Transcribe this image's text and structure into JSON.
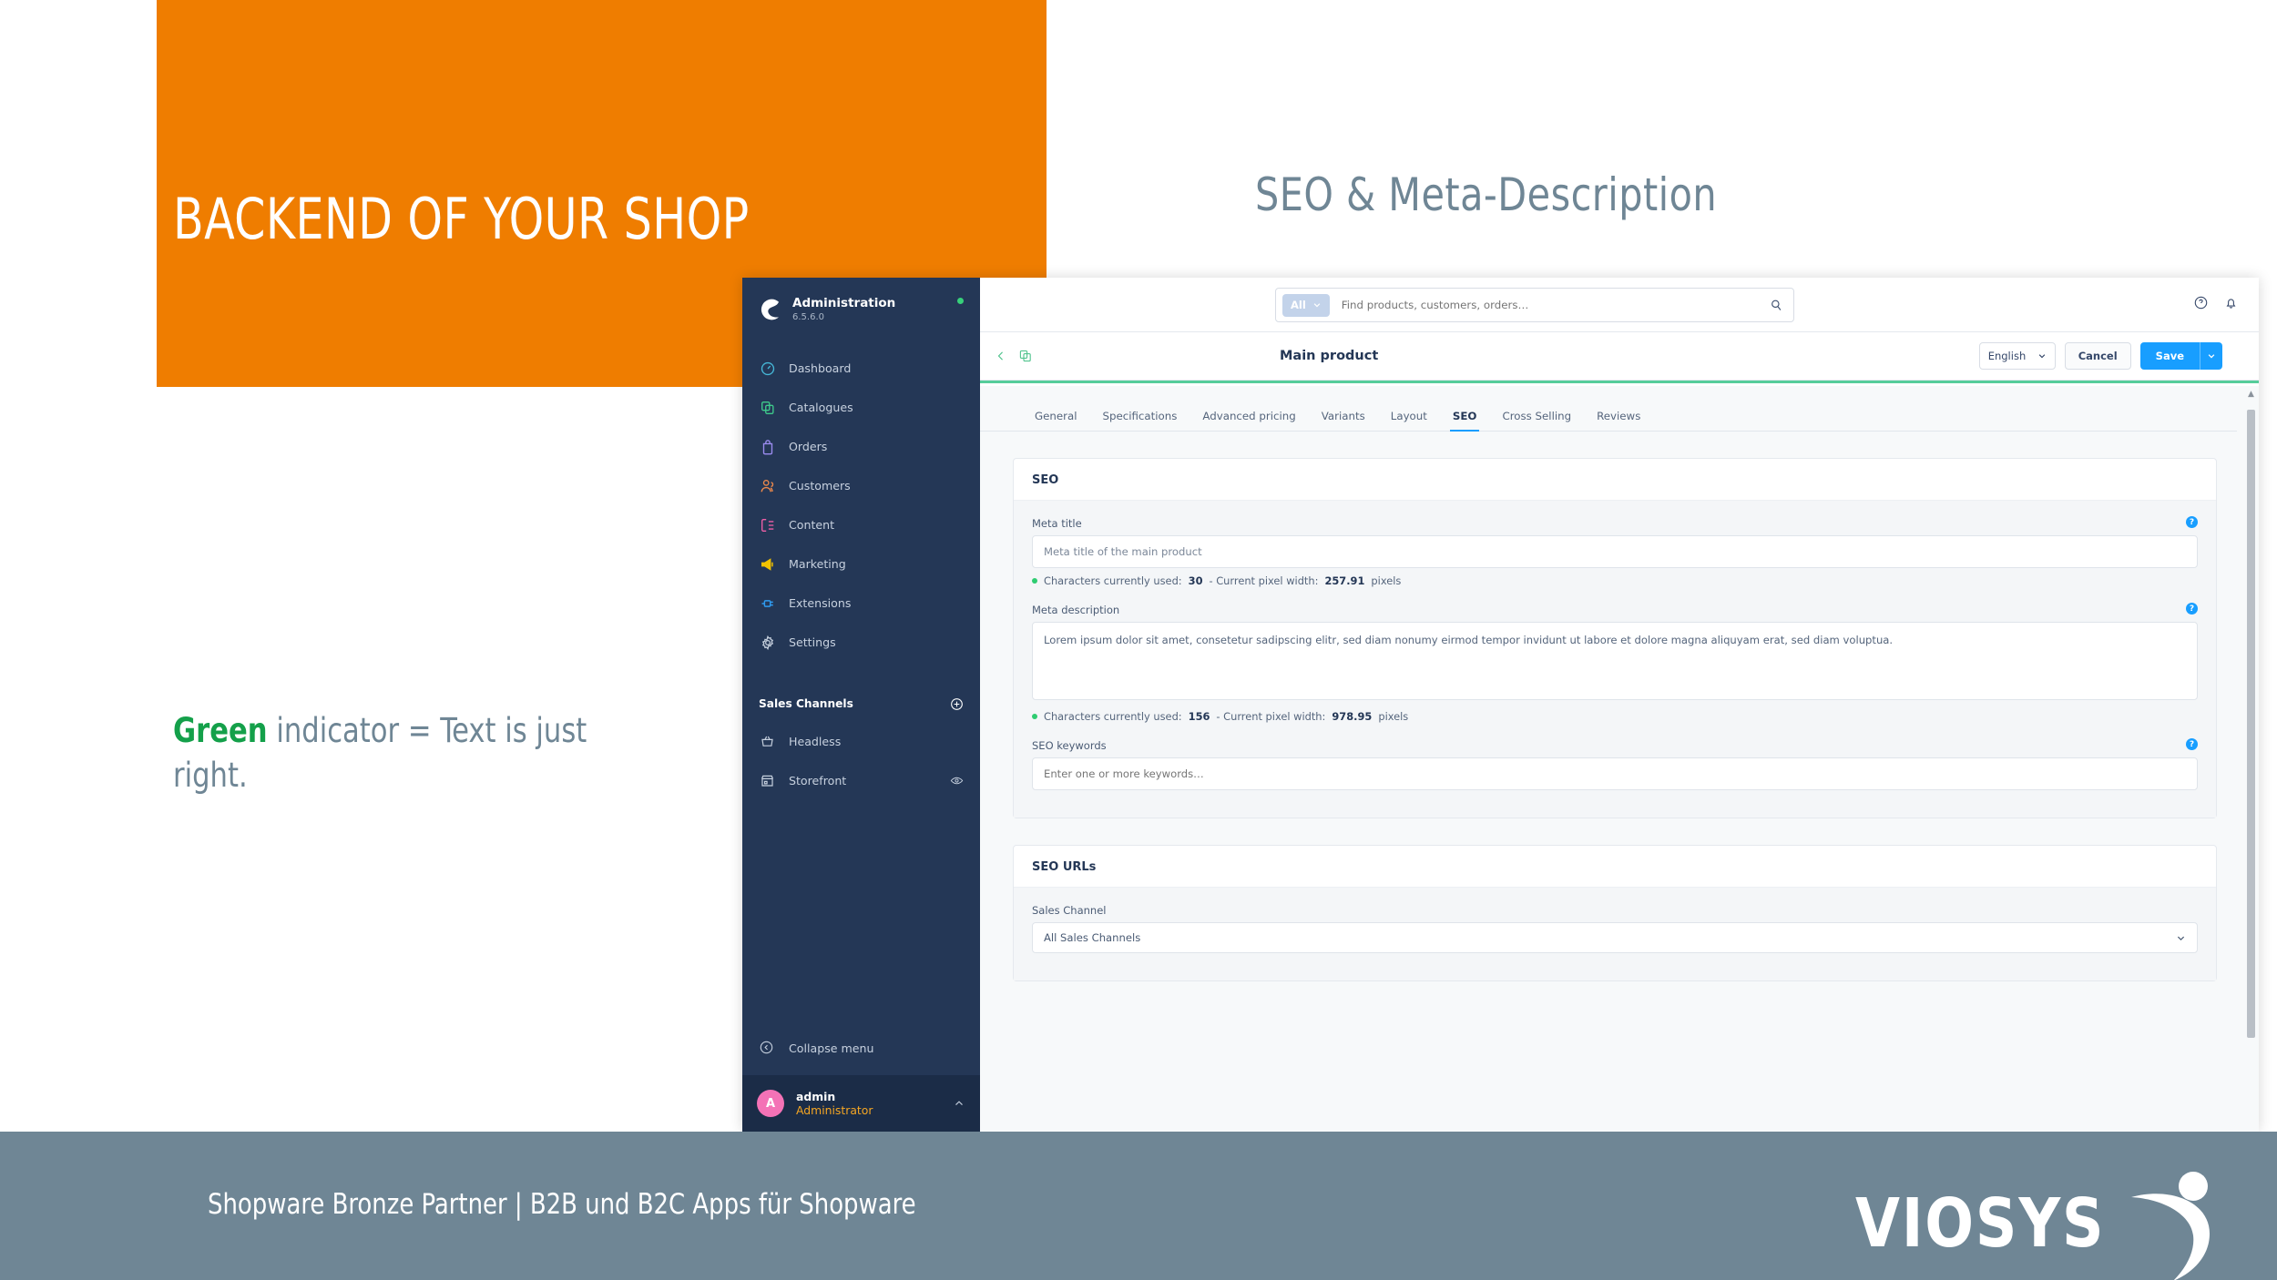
{
  "theme": {
    "orange": "#EF7D00",
    "slate": "#6F8695",
    "green": "#14A04A",
    "sidebar_navy": "#243756",
    "primary_blue": "#189EFF",
    "accent_green": "#56CD9A"
  },
  "slide": {
    "title": "BACKEND OF YOUR SHOP",
    "headline": "SEO & Meta-Description",
    "caption_highlight": "Green",
    "caption_rest": " indicator = Text is just right."
  },
  "footer": {
    "text": "Shopware Bronze Partner  |  B2B und B2C Apps für Shopware",
    "logo_text": "VIOSYS"
  },
  "app": {
    "sidebar": {
      "brand_name": "Administration",
      "brand_version": "6.5.6.0",
      "status_indicator": "online-dot",
      "nav": [
        {
          "label": "Dashboard",
          "icon": "gauge-icon"
        },
        {
          "label": "Catalogues",
          "icon": "copy-icon"
        },
        {
          "label": "Orders",
          "icon": "bag-icon"
        },
        {
          "label": "Customers",
          "icon": "users-icon"
        },
        {
          "label": "Content",
          "icon": "content-icon"
        },
        {
          "label": "Marketing",
          "icon": "megaphone-icon"
        },
        {
          "label": "Extensions",
          "icon": "plug-icon"
        },
        {
          "label": "Settings",
          "icon": "gear-icon"
        }
      ],
      "group_label": "Sales Channels",
      "channels": [
        {
          "label": "Headless",
          "icon": "basket-icon"
        },
        {
          "label": "Storefront",
          "icon": "store-icon"
        }
      ],
      "collapse_label": "Collapse menu",
      "user_initial": "A",
      "user_name": "admin",
      "user_role": "Administrator"
    },
    "topbar": {
      "scope_label": "All",
      "search_placeholder": "Find products, customers, orders…",
      "search_value": ""
    },
    "subbar": {
      "title": "Main product",
      "language": "English",
      "cancel_label": "Cancel",
      "save_label": "Save"
    },
    "tabs": [
      {
        "label": "General",
        "active": false
      },
      {
        "label": "Specifications",
        "active": false
      },
      {
        "label": "Advanced pricing",
        "active": false
      },
      {
        "label": "Variants",
        "active": false
      },
      {
        "label": "Layout",
        "active": false
      },
      {
        "label": "SEO",
        "active": true
      },
      {
        "label": "Cross Selling",
        "active": false
      },
      {
        "label": "Reviews",
        "active": false
      }
    ],
    "seo_card": {
      "title": "SEO",
      "meta_title": {
        "label": "Meta title",
        "value": "Meta title of the main product",
        "counter_prefix": "Characters currently used:",
        "chars": "30",
        "counter_mid": "- Current pixel width:",
        "pixels": "257.91",
        "counter_suffix": "pixels"
      },
      "meta_description": {
        "label": "Meta description",
        "value": "Lorem ipsum dolor sit amet, consetetur sadipscing elitr, sed diam nonumy eirmod tempor invidunt ut labore et dolore magna aliquyam erat, sed diam voluptua.",
        "counter_prefix": "Characters currently used:",
        "chars": "156",
        "counter_mid": "- Current pixel width:",
        "pixels": "978.95",
        "counter_suffix": "pixels"
      },
      "seo_keywords": {
        "label": "SEO keywords",
        "placeholder": "Enter one or more keywords…",
        "value": ""
      }
    },
    "seo_urls_card": {
      "title": "SEO URLs",
      "sales_channel_label": "Sales Channel",
      "sales_channel_value": "All Sales Channels"
    }
  }
}
